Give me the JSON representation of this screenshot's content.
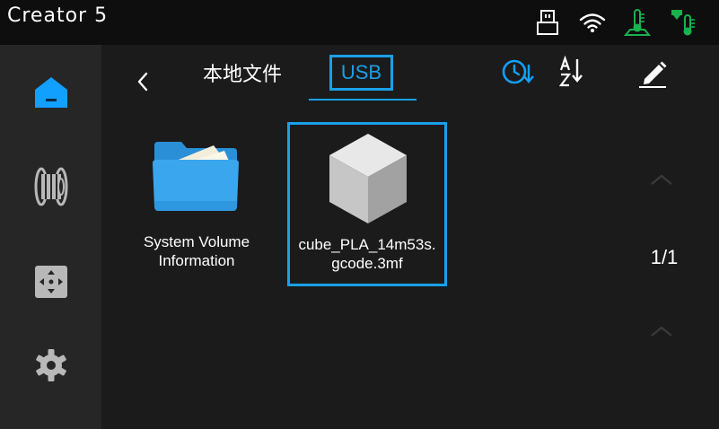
{
  "header": {
    "title": "Creator 5",
    "status_icons": [
      "usb-icon",
      "wifi-icon",
      "bed-temperature-icon",
      "nozzle-temperature-icon"
    ]
  },
  "sidebar": {
    "items": [
      {
        "name": "home",
        "icon": "home-icon",
        "active": true
      },
      {
        "name": "filament",
        "icon": "filament-spool-icon",
        "active": false
      },
      {
        "name": "move",
        "icon": "move-control-icon",
        "active": false
      },
      {
        "name": "settings",
        "icon": "gear-icon",
        "active": false
      }
    ]
  },
  "tabs": {
    "local_label": "本地文件",
    "usb_label": "USB",
    "active": "usb"
  },
  "toolbar": {
    "icons": [
      "sort-by-time-icon",
      "sort-alphabetical-icon",
      "edit-icon"
    ]
  },
  "files": [
    {
      "icon": "folder-icon",
      "line1": "System Volume",
      "line2": "Information",
      "selected": false
    },
    {
      "icon": "model-cube-icon",
      "line1": "cube_PLA_14m53s.",
      "line2": "gcode.3mf",
      "selected": true
    }
  ],
  "pagination": {
    "text": "1/1"
  },
  "colors": {
    "accent": "#1aa0e8",
    "active_nav": "#12a0ff",
    "temperature_green": "#19b24c",
    "folder_blue": "#3aa6ee",
    "background": "#1b1b1b",
    "sidebar": "#262626",
    "statusbar": "#0e0e0e"
  }
}
